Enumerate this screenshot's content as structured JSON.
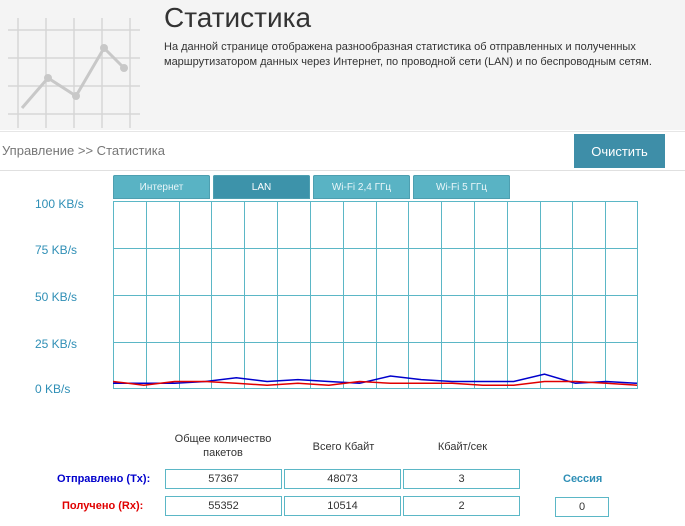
{
  "header": {
    "title": "Статистика",
    "description": "На данной странице отображена разнообразная статистика об отправленных и полученных маршрутизатором данных через Интернет, по проводной сети (LAN) и по беспроводным сетям."
  },
  "breadcrumb": "Управление >> Статистика",
  "toolbar": {
    "clear_label": "Очистить"
  },
  "tabs": [
    {
      "label": "Интернет",
      "active": false
    },
    {
      "label": "LAN",
      "active": true
    },
    {
      "label": "Wi-Fi 2,4 ГГц",
      "active": false
    },
    {
      "label": "Wi-Fi 5 ГГц",
      "active": false
    }
  ],
  "chart_data": {
    "type": "line",
    "y_ticks": [
      "100 KB/s",
      "75 KB/s",
      "50 KB/s",
      "25 KB/s",
      "0 KB/s"
    ],
    "ylim": [
      0,
      100
    ],
    "grid": true,
    "series": [
      {
        "color": "#0000cc",
        "values": [
          2,
          2,
          2,
          3,
          5,
          3,
          4,
          3,
          2,
          6,
          4,
          3,
          3,
          3,
          7,
          2,
          3,
          2
        ]
      },
      {
        "color": "#e00000",
        "values": [
          3,
          1,
          3,
          3,
          2,
          1,
          2,
          1,
          3,
          2,
          2,
          2,
          1,
          1,
          3,
          3,
          2,
          1
        ]
      }
    ]
  },
  "stats": {
    "columns": [
      "Общее количество пакетов",
      "Всего Кбайт",
      "Кбайт/сек"
    ],
    "rows": [
      {
        "label": "Отправлено (Tx):",
        "color": "#0000cc",
        "values": [
          "57367",
          "48073",
          "3"
        ]
      },
      {
        "label": "Получено (Rx):",
        "color": "#e00000",
        "values": [
          "55352",
          "10514",
          "2"
        ]
      }
    ],
    "session_label": "Сессия",
    "session_value": "0"
  },
  "colors": {
    "accent": "#3e8ea8",
    "tab": "#59b3c4",
    "grid": "#5bb7c6",
    "y_label": "#2f8fb6"
  },
  "icons": {
    "logo": "line-chart-grid-icon"
  }
}
